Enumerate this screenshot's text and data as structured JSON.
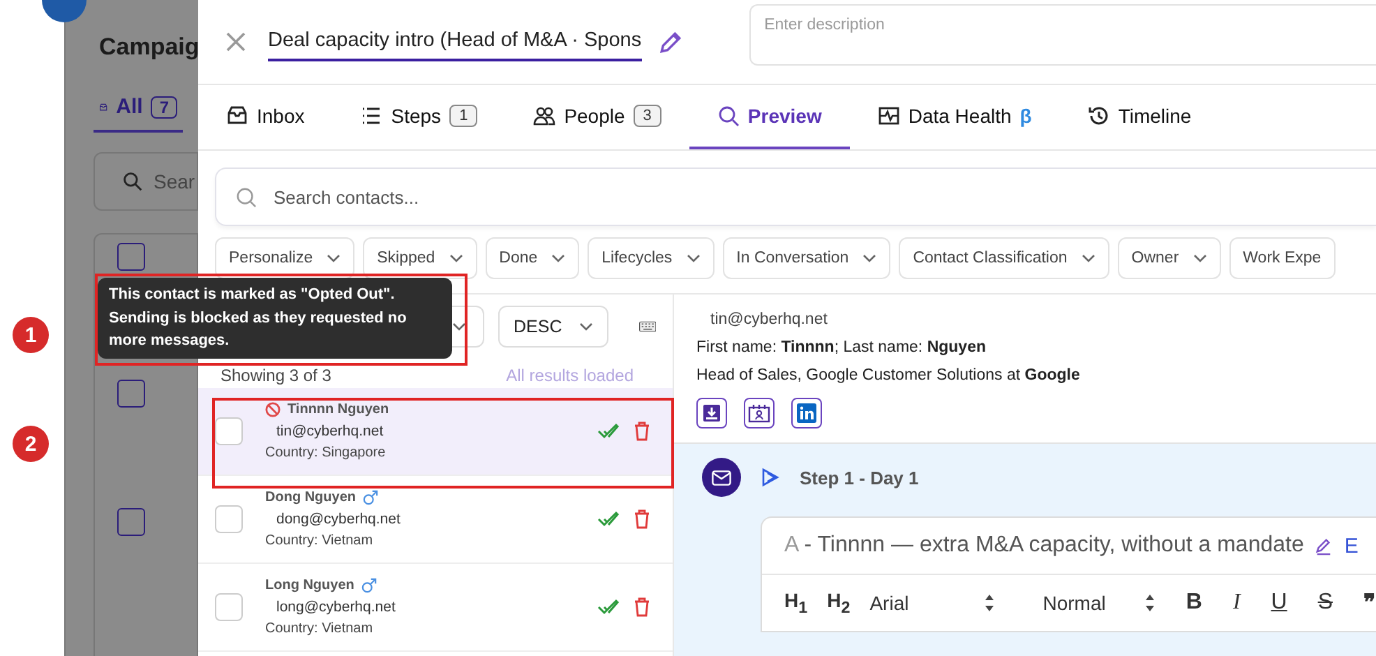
{
  "annotations": [
    {
      "number": "1"
    },
    {
      "number": "2"
    }
  ],
  "background_page": {
    "title": "Campaig",
    "tab": {
      "label": "All",
      "count": "7",
      "selected": true
    },
    "search": {
      "placeholder": "Sear"
    },
    "rows": [
      {
        "checked": false
      },
      {
        "checked": false
      },
      {
        "checked": false
      }
    ]
  },
  "panel": {
    "title": "Deal capacity intro (Head of M&A · Spons",
    "description": {
      "placeholder": "Enter description"
    }
  },
  "tabs": [
    {
      "label": "Inbox",
      "selected": false
    },
    {
      "label": "Steps",
      "count": "1",
      "selected": false
    },
    {
      "label": "People",
      "count": "3",
      "selected": false
    },
    {
      "label": "Preview",
      "selected": true
    },
    {
      "label": "Data Health",
      "suffix": "β",
      "selected": false
    },
    {
      "label": "Timeline",
      "selected": false
    }
  ],
  "search": {
    "placeholder": "Search contacts..."
  },
  "filters": [
    "Personalize",
    "Skipped",
    "Done",
    "Lifecycles",
    "In Conversation",
    "Contact Classification",
    "Owner",
    "Work Expe"
  ],
  "sort": {
    "order": "DESC"
  },
  "list_status": {
    "count_text": "Showing 3 of 3",
    "loaded_text": "All results loaded"
  },
  "contacts": [
    {
      "name": "Tinnnn Nguyen",
      "opted_out": true,
      "male": false,
      "email": "tin@cyberhq.net",
      "country": "Country: Singapore",
      "selected": true,
      "checked": false
    },
    {
      "name": "Dong Nguyen",
      "opted_out": false,
      "male": true,
      "email": "dong@cyberhq.net",
      "country": "Country: Vietnam",
      "selected": false,
      "checked": false
    },
    {
      "name": "Long Nguyen",
      "opted_out": false,
      "male": true,
      "email": "long@cyberhq.net",
      "country": "Country: Vietnam",
      "selected": false,
      "checked": false
    }
  ],
  "tooltip": {
    "text": "This contact is marked as \"Opted Out\". Sending is blocked as they requested no more messages."
  },
  "preview": {
    "email": "tin@cyberhq.net",
    "names": "First name: **Tinnnn**; Last name: **Nguyen**",
    "headline": "Head of Sales, Google Customer Solutions at **Google**",
    "step": {
      "title": "Step 1 - Day 1",
      "variant": "A",
      "subject": "- Tinnnn — extra M&A capacity, without a mandate",
      "edit_label": "E",
      "toolbar": {
        "headings": [
          "H$_{1}$",
          "H$_{2}$"
        ],
        "font": "Arial",
        "size": "Normal",
        "formats": [
          {
            "label": "B",
            "kind": "bold"
          },
          {
            "label": "I",
            "kind": "italic"
          },
          {
            "label": "U",
            "kind": "underline"
          },
          {
            "label": "S",
            "kind": "strike"
          },
          {
            "label": "❞",
            "kind": "quote"
          }
        ]
      }
    }
  }
}
